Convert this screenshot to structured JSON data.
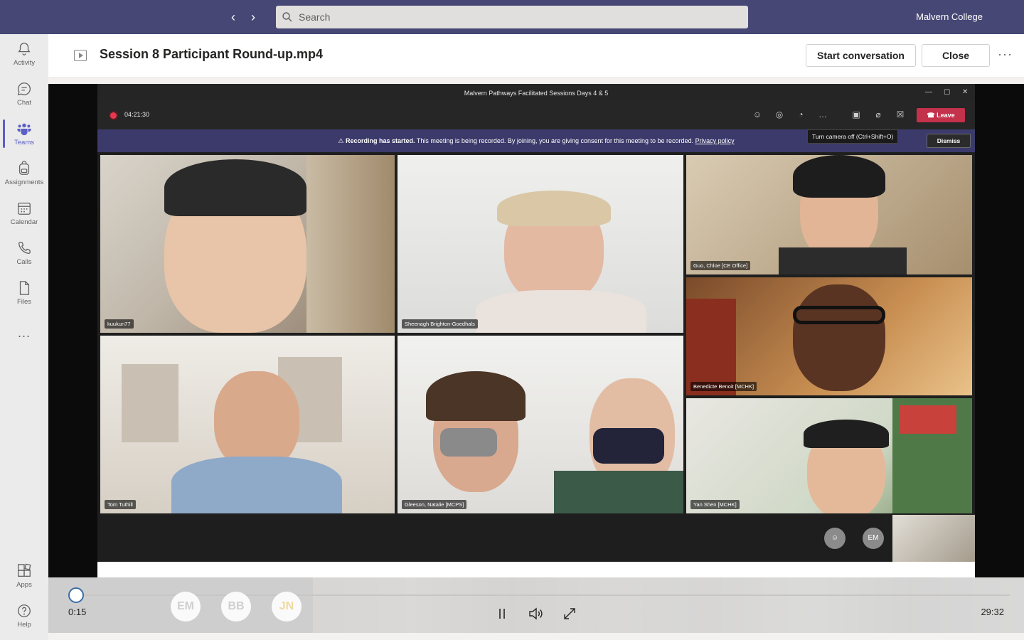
{
  "topbar": {
    "search_placeholder": "Search",
    "org_name": "Malvern College"
  },
  "rail": {
    "items": [
      {
        "label": "Activity",
        "icon": "bell-icon"
      },
      {
        "label": "Chat",
        "icon": "chat-icon"
      },
      {
        "label": "Teams",
        "icon": "teams-icon",
        "active": true
      },
      {
        "label": "Assignments",
        "icon": "backpack-icon"
      },
      {
        "label": "Calendar",
        "icon": "calendar-icon"
      },
      {
        "label": "Calls",
        "icon": "phone-icon"
      },
      {
        "label": "Files",
        "icon": "file-icon"
      }
    ],
    "more_label": "...",
    "bottom": [
      {
        "label": "Apps",
        "icon": "apps-icon"
      },
      {
        "label": "Help",
        "icon": "help-icon"
      }
    ]
  },
  "header": {
    "file_title": "Session 8 Participant Round-up.mp4",
    "start_conversation": "Start conversation",
    "close": "Close",
    "more": "···"
  },
  "meeting": {
    "window_title": "Malvern Pathways Facilitated Sessions Days 4 & 5",
    "timer": "04:21:30",
    "leave_label": "Leave",
    "banner_bold": "Recording has started.",
    "banner_text": "This meeting is being recorded. By joining, you are giving consent for this meeting to be recorded.",
    "banner_link": "Privacy policy",
    "dismiss_label": "Dismiss",
    "tooltip": "Turn camera off (Ctrl+Shift+O)",
    "participants": [
      {
        "name": "kuukun77"
      },
      {
        "name": "Sheenagh Brighton-Goedhals"
      },
      {
        "name": "Guo, Chloe [CE Office]"
      },
      {
        "name": "Benedicte Benoit [MCHK]"
      },
      {
        "name": "Tom Tuthill"
      },
      {
        "name": "Gleeson, Natalie [MCPS]"
      },
      {
        "name": "Yan Shen [MCHK]"
      }
    ],
    "strip_avatars": [
      "EM"
    ],
    "accent_red": "#c4314b",
    "banner_color": "#3b3a6b"
  },
  "player": {
    "current_time": "0:15",
    "duration": "29:32",
    "progress_fraction": 0.008,
    "viewers": [
      "EM",
      "BB",
      "JN"
    ],
    "accent": "#3a6ea5"
  }
}
